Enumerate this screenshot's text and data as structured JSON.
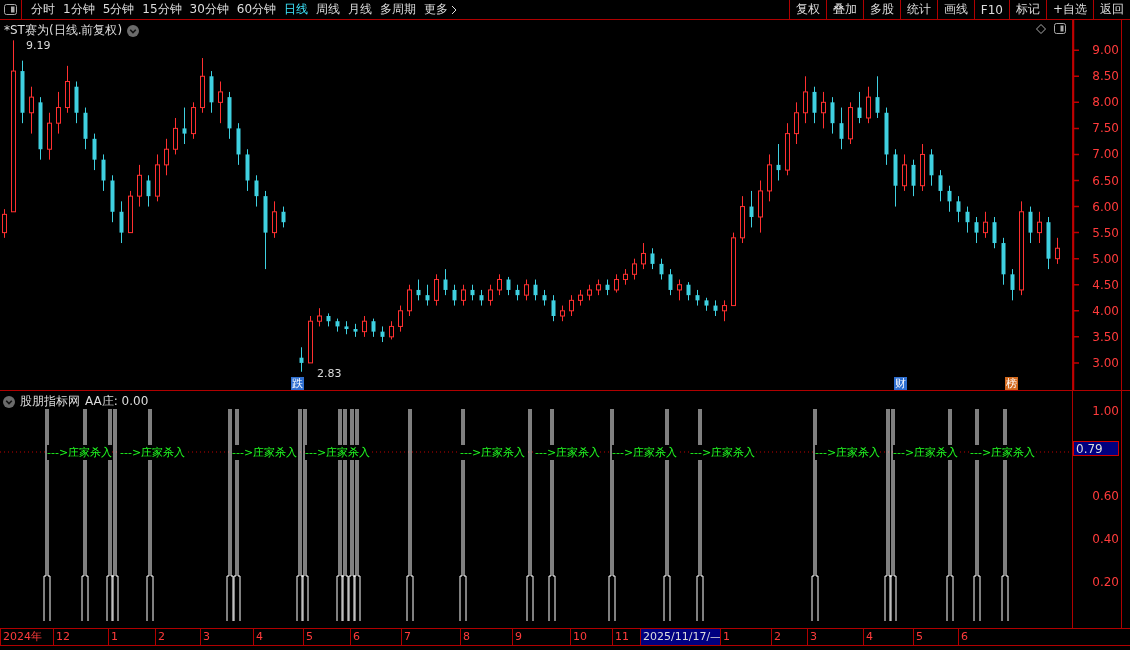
{
  "toolbar": {
    "periods": [
      {
        "label": "分时",
        "selected": false
      },
      {
        "label": "1分钟",
        "selected": false
      },
      {
        "label": "5分钟",
        "selected": false
      },
      {
        "label": "15分钟",
        "selected": false
      },
      {
        "label": "30分钟",
        "selected": false
      },
      {
        "label": "60分钟",
        "selected": false
      },
      {
        "label": "日线",
        "selected": true
      },
      {
        "label": "周线",
        "selected": false
      },
      {
        "label": "月线",
        "selected": false
      },
      {
        "label": "多周期",
        "selected": false
      }
    ],
    "more": "更多",
    "actions": [
      "复权",
      "叠加",
      "多股",
      "统计",
      "画线",
      "F10",
      "标记",
      "+自选",
      "返回"
    ]
  },
  "price_chart": {
    "title": "*ST赛为(日线.前复权)",
    "high_label": "9.19",
    "low_label": "2.83",
    "markers": [
      {
        "label": "跌",
        "color": "#2f6fd0"
      },
      {
        "label": "财",
        "color": "#2f6fd0"
      },
      {
        "label": "榜",
        "color": "#d2691e"
      }
    ],
    "chart_data": {
      "type": "candlestick",
      "ylim": [
        2.48,
        9.58
      ],
      "yticks": [
        {
          "value": 9,
          "label": "9.00"
        },
        {
          "value": 8.5,
          "label": "8.50"
        },
        {
          "value": 8,
          "label": "8.00"
        },
        {
          "value": 7.5,
          "label": "7.50"
        },
        {
          "value": 7,
          "label": "7.00"
        },
        {
          "value": 6.5,
          "label": "6.50"
        },
        {
          "value": 6,
          "label": "6.00"
        },
        {
          "value": 5.5,
          "label": "5.50"
        },
        {
          "value": 5,
          "label": "5.00"
        },
        {
          "value": 4.5,
          "label": "4.50"
        },
        {
          "value": 4,
          "label": "4.00"
        },
        {
          "value": 3.5,
          "label": "3.50"
        },
        {
          "value": 3,
          "label": "3.00"
        }
      ],
      "ohlc": [
        [
          5.5,
          5.95,
          5.4,
          5.85
        ],
        [
          5.9,
          9.19,
          5.9,
          8.6
        ],
        [
          8.6,
          8.8,
          7.6,
          7.8
        ],
        [
          7.8,
          8.3,
          7.4,
          8.1
        ],
        [
          8.0,
          8.1,
          6.9,
          7.1
        ],
        [
          7.1,
          7.8,
          6.9,
          7.6
        ],
        [
          7.6,
          8.2,
          7.4,
          7.9
        ],
        [
          7.9,
          8.7,
          7.8,
          8.4
        ],
        [
          8.3,
          8.4,
          7.6,
          7.8
        ],
        [
          7.8,
          7.9,
          7.1,
          7.3
        ],
        [
          7.3,
          7.4,
          6.7,
          6.9
        ],
        [
          6.9,
          7.0,
          6.3,
          6.5
        ],
        [
          6.5,
          6.6,
          5.7,
          5.9
        ],
        [
          5.9,
          6.1,
          5.3,
          5.5
        ],
        [
          5.5,
          6.3,
          5.5,
          6.2
        ],
        [
          6.2,
          6.8,
          6.0,
          6.6
        ],
        [
          6.5,
          6.6,
          6.0,
          6.2
        ],
        [
          6.2,
          7.0,
          6.1,
          6.8
        ],
        [
          6.8,
          7.3,
          6.6,
          7.1
        ],
        [
          7.1,
          7.7,
          7.0,
          7.5
        ],
        [
          7.5,
          7.9,
          7.2,
          7.4
        ],
        [
          7.4,
          8.0,
          7.3,
          7.9
        ],
        [
          7.9,
          8.85,
          7.8,
          8.5
        ],
        [
          8.5,
          8.6,
          7.8,
          8.0
        ],
        [
          8.0,
          8.4,
          7.6,
          8.2
        ],
        [
          8.1,
          8.2,
          7.3,
          7.5
        ],
        [
          7.5,
          7.6,
          6.8,
          7.0
        ],
        [
          7.0,
          7.1,
          6.3,
          6.5
        ],
        [
          6.5,
          6.6,
          6.0,
          6.2
        ],
        [
          6.2,
          6.3,
          4.8,
          5.5
        ],
        [
          5.5,
          6.1,
          5.4,
          5.9
        ],
        [
          5.9,
          6.0,
          5.6,
          5.7
        ],
        null,
        [
          3.1,
          3.3,
          2.83,
          3.0
        ],
        [
          3.0,
          3.9,
          3.0,
          3.8
        ],
        [
          3.8,
          4.05,
          3.7,
          3.9
        ],
        [
          3.9,
          3.95,
          3.7,
          3.8
        ],
        [
          3.8,
          3.85,
          3.6,
          3.7
        ],
        [
          3.7,
          3.8,
          3.55,
          3.65
        ],
        [
          3.65,
          3.75,
          3.5,
          3.6
        ],
        [
          3.6,
          3.9,
          3.5,
          3.8
        ],
        [
          3.8,
          3.85,
          3.5,
          3.6
        ],
        [
          3.6,
          3.7,
          3.4,
          3.5
        ],
        [
          3.5,
          3.8,
          3.45,
          3.7
        ],
        [
          3.7,
          4.1,
          3.6,
          4.0
        ],
        [
          4.0,
          4.5,
          3.9,
          4.4
        ],
        [
          4.4,
          4.6,
          4.2,
          4.3
        ],
        [
          4.3,
          4.5,
          4.1,
          4.2
        ],
        [
          4.2,
          4.7,
          4.1,
          4.6
        ],
        [
          4.6,
          4.8,
          4.3,
          4.4
        ],
        [
          4.4,
          4.5,
          4.1,
          4.2
        ],
        [
          4.2,
          4.5,
          4.1,
          4.4
        ],
        [
          4.4,
          4.5,
          4.2,
          4.3
        ],
        [
          4.3,
          4.4,
          4.1,
          4.2
        ],
        [
          4.2,
          4.5,
          4.1,
          4.4
        ],
        [
          4.4,
          4.7,
          4.3,
          4.6
        ],
        [
          4.6,
          4.65,
          4.3,
          4.4
        ],
        [
          4.4,
          4.5,
          4.2,
          4.3
        ],
        [
          4.3,
          4.6,
          4.2,
          4.5
        ],
        [
          4.5,
          4.6,
          4.2,
          4.3
        ],
        [
          4.3,
          4.4,
          4.1,
          4.2
        ],
        [
          4.2,
          4.3,
          3.8,
          3.9
        ],
        [
          3.9,
          4.1,
          3.8,
          4.0
        ],
        [
          4.0,
          4.3,
          3.9,
          4.2
        ],
        [
          4.2,
          4.4,
          4.1,
          4.3
        ],
        [
          4.3,
          4.5,
          4.2,
          4.4
        ],
        [
          4.4,
          4.6,
          4.3,
          4.5
        ],
        [
          4.5,
          4.6,
          4.3,
          4.4
        ],
        [
          4.4,
          4.7,
          4.35,
          4.6
        ],
        [
          4.6,
          4.8,
          4.5,
          4.7
        ],
        [
          4.7,
          5.0,
          4.6,
          4.9
        ],
        [
          4.9,
          5.3,
          4.8,
          5.1
        ],
        [
          5.1,
          5.2,
          4.8,
          4.9
        ],
        [
          4.9,
          5.0,
          4.6,
          4.7
        ],
        [
          4.7,
          4.8,
          4.3,
          4.4
        ],
        [
          4.4,
          4.6,
          4.2,
          4.5
        ],
        [
          4.5,
          4.55,
          4.2,
          4.3
        ],
        [
          4.3,
          4.4,
          4.1,
          4.2
        ],
        [
          4.2,
          4.25,
          4.0,
          4.1
        ],
        [
          4.1,
          4.2,
          3.9,
          4.0
        ],
        [
          4.0,
          4.2,
          3.8,
          4.1
        ],
        [
          4.1,
          5.5,
          4.1,
          5.4
        ],
        [
          5.4,
          6.2,
          5.3,
          6.0
        ],
        [
          6.0,
          6.3,
          5.6,
          5.8
        ],
        [
          5.8,
          6.5,
          5.5,
          6.3
        ],
        [
          6.3,
          7.0,
          6.1,
          6.8
        ],
        [
          6.8,
          7.2,
          6.5,
          6.7
        ],
        [
          6.7,
          7.6,
          6.6,
          7.4
        ],
        [
          7.4,
          8.0,
          7.2,
          7.8
        ],
        [
          7.8,
          8.5,
          7.6,
          8.2
        ],
        [
          8.2,
          8.3,
          7.6,
          7.8
        ],
        [
          7.8,
          8.2,
          7.5,
          8.0
        ],
        [
          8.0,
          8.1,
          7.4,
          7.6
        ],
        [
          7.6,
          7.9,
          7.1,
          7.3
        ],
        [
          7.3,
          8.0,
          7.2,
          7.9
        ],
        [
          7.9,
          8.2,
          7.6,
          7.7
        ],
        [
          7.7,
          8.3,
          7.6,
          8.1
        ],
        [
          8.1,
          8.5,
          7.7,
          7.8
        ],
        [
          7.8,
          7.9,
          6.8,
          7.0
        ],
        [
          7.0,
          7.1,
          6.0,
          6.4
        ],
        [
          6.4,
          7.0,
          6.3,
          6.8
        ],
        [
          6.8,
          6.9,
          6.2,
          6.4
        ],
        [
          6.4,
          7.2,
          6.3,
          7.0
        ],
        [
          7.0,
          7.1,
          6.4,
          6.6
        ],
        [
          6.6,
          6.7,
          6.1,
          6.3
        ],
        [
          6.3,
          6.4,
          5.9,
          6.1
        ],
        [
          6.1,
          6.2,
          5.7,
          5.9
        ],
        [
          5.9,
          6.0,
          5.5,
          5.7
        ],
        [
          5.7,
          5.8,
          5.3,
          5.5
        ],
        [
          5.5,
          5.9,
          5.4,
          5.7
        ],
        [
          5.7,
          5.8,
          5.2,
          5.3
        ],
        [
          5.3,
          5.4,
          4.5,
          4.7
        ],
        [
          4.7,
          4.8,
          4.2,
          4.4
        ],
        [
          4.4,
          6.1,
          4.3,
          5.9
        ],
        [
          5.9,
          6.0,
          5.3,
          5.5
        ],
        [
          5.5,
          5.9,
          5.3,
          5.7
        ],
        [
          5.7,
          5.8,
          4.8,
          5.0
        ],
        [
          5.0,
          5.4,
          4.9,
          5.2
        ]
      ]
    }
  },
  "indicator": {
    "name": "股朋指标网",
    "reading": "AA庄: 0.00",
    "current_value": "0.79",
    "signals": [
      "--->庄家杀入",
      "--->庄家杀入",
      "--->庄家杀入",
      "--->庄家杀入",
      "--->庄家杀入",
      "--->庄家杀入",
      "--->庄家杀入",
      "--->庄家杀入",
      "--->庄家杀入",
      "--->庄家杀入",
      "--->庄家杀入"
    ],
    "y_ticks": [
      "1.00",
      "0.60",
      "0.40",
      "0.20"
    ]
  },
  "time_axis": {
    "labels": [
      {
        "label": "2024年",
        "selected": false
      },
      {
        "label": "12",
        "selected": false
      },
      {
        "label": "1",
        "selected": false
      },
      {
        "label": "2",
        "selected": false
      },
      {
        "label": "3",
        "selected": false
      },
      {
        "label": "4",
        "selected": false
      },
      {
        "label": "5",
        "selected": false
      },
      {
        "label": "6",
        "selected": false
      },
      {
        "label": "7",
        "selected": false
      },
      {
        "label": "8",
        "selected": false
      },
      {
        "label": "9",
        "selected": false
      },
      {
        "label": "10",
        "selected": false
      },
      {
        "label": "11",
        "selected": false
      },
      {
        "label": "2025/11/17/—",
        "selected": true
      },
      {
        "label": "1",
        "selected": false
      },
      {
        "label": "2",
        "selected": false
      },
      {
        "label": "3",
        "selected": false
      },
      {
        "label": "4",
        "selected": false
      },
      {
        "label": "5",
        "selected": false
      },
      {
        "label": "6",
        "selected": false
      }
    ]
  }
}
